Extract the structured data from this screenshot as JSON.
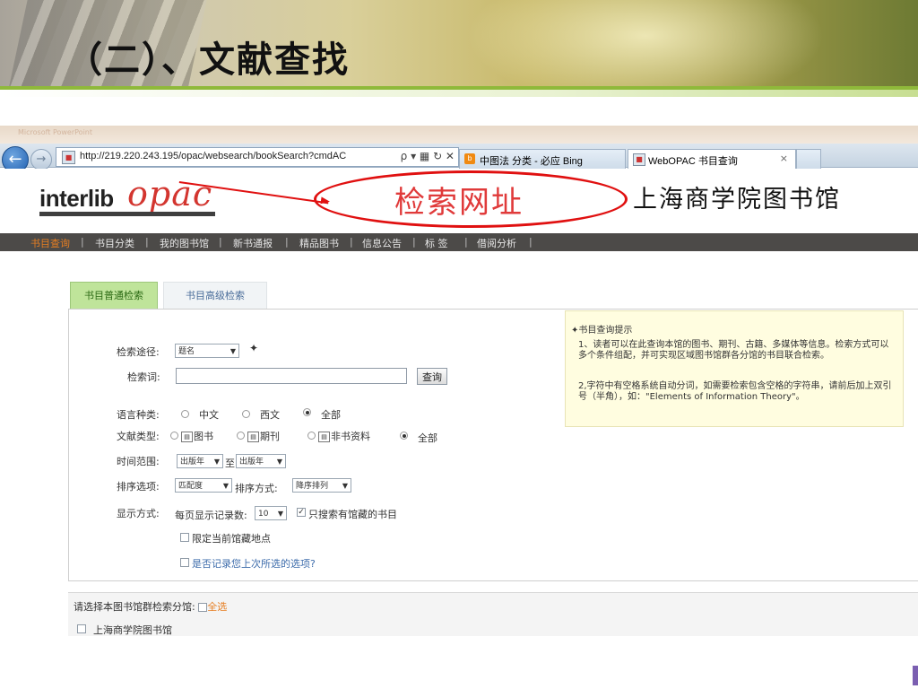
{
  "slide": {
    "title": "（二）、文献查找",
    "annotation": "检索网址"
  },
  "browser": {
    "window_title": "Microsoft PowerPoint",
    "back_icon": "arrow-left-icon",
    "forward_icon": "arrow-right-icon",
    "address": {
      "url": "http://219.220.243.195/opac/websearch/bookSearch?cmdAC",
      "tools": "ρ ▾ ▦ ↻ ✕"
    },
    "tabs": [
      {
        "label": "中图法 分类 - 必应 Bing",
        "icon": "bing-icon"
      },
      {
        "label": "WebOPAC 书目查询",
        "icon": "page-icon",
        "close": "×"
      }
    ]
  },
  "site": {
    "logo_main": "interlib",
    "logo_accent": "opac",
    "library_name": "上海商学院图书馆",
    "nav": [
      "书目查询",
      "书目分类",
      "我的图书馆",
      "新书通报",
      "精品图书",
      "信息公告",
      "标 签",
      "借阅分析"
    ],
    "nav_separator": "|",
    "search_tabs": [
      "书目普通检索",
      "书目高级检索"
    ]
  },
  "form": {
    "search_path_label": "检索途径:",
    "search_path_value": "题名",
    "keyword_label": "检索词:",
    "keyword_value": "",
    "query_button": "查询",
    "language_label": "语言种类:",
    "language_options": [
      "中文",
      "西文",
      "全部"
    ],
    "language_selected": "全部",
    "doctype_label": "文献类型:",
    "doctype_options": [
      "图书",
      "期刊",
      "非书资料",
      "全部"
    ],
    "doctype_selected": "全部",
    "time_label": "时间范围:",
    "time_from": "出版年",
    "time_to_text": "至",
    "time_to": "出版年",
    "sort_label": "排序选项:",
    "sort_value": "匹配度",
    "sort_method_label": "排序方式:",
    "sort_method_value": "降序排列",
    "display_label": "显示方式:",
    "per_page_label": "每页显示记录数:",
    "per_page_value": "10",
    "only_holdings": "只搜索有馆藏的书目",
    "only_holdings_checked": true,
    "limit_location": "限定当前馆藏地点",
    "limit_location_checked": false,
    "remember_options": "是否记录您上次所选的选项?",
    "remember_checked": false
  },
  "hint": {
    "title": "书目查询提示",
    "para1": "1、读者可以在此查询本馆的图书、期刊、古籍、多媒体等信息。检索方式可以多个条件组配，并可实现区域图书馆群各分馆的书目联合检索。",
    "para2": "2,字符中有空格系统自动分词，如需要检索包含空格的字符串，请前后加上双引号（半角），如：\"Elements of Information Theory\"。"
  },
  "branches": {
    "label": "请选择本图书馆群检索分馆:",
    "select_all": "全选",
    "items": [
      "上海商学院图书馆"
    ]
  },
  "colors": {
    "accent_orange": "#e67e22",
    "annotation_red": "#e01010",
    "tab_green": "#bfe49a",
    "hint_yellow": "#fffde0",
    "nav_dark": "#4c4a48"
  }
}
